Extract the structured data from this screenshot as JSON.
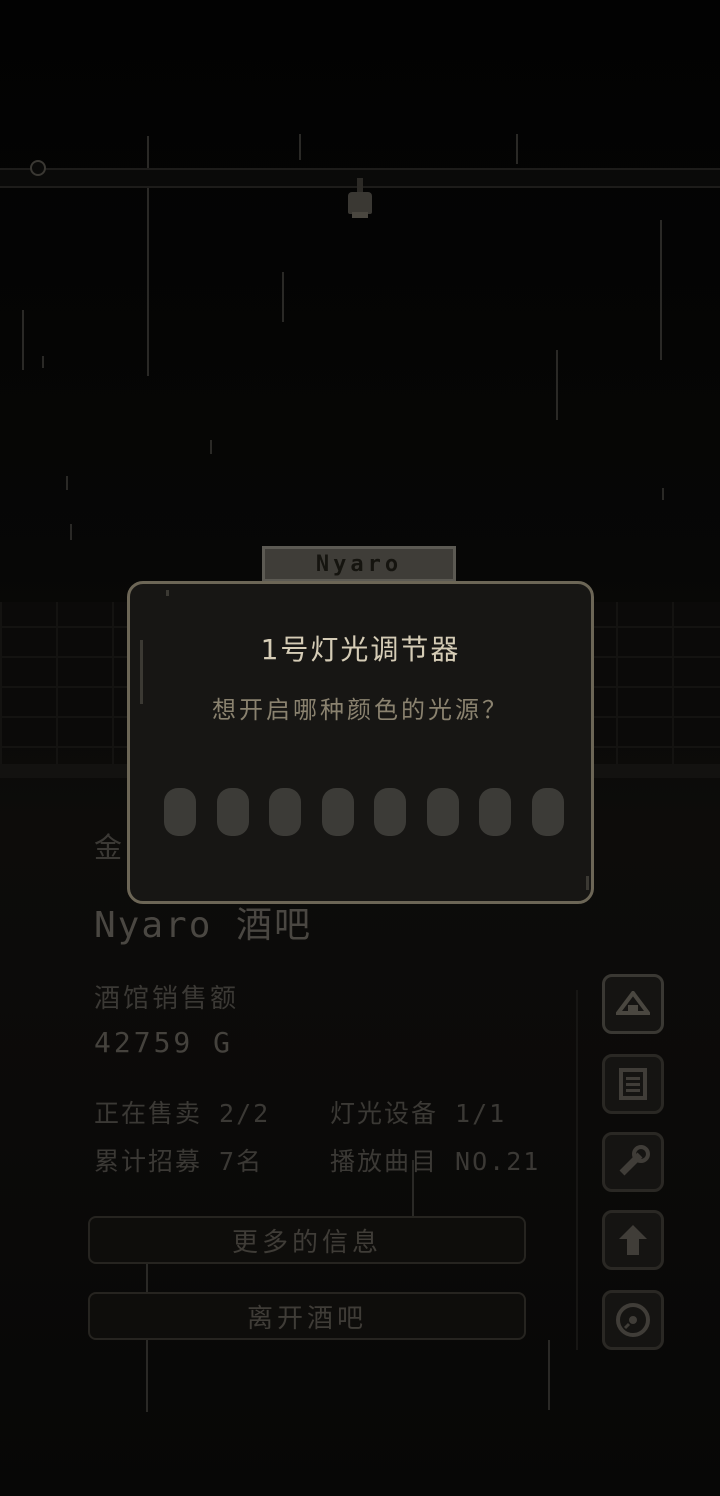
{
  "sign": {
    "text": "Nyaro"
  },
  "dialog": {
    "title": "1号灯光调节器",
    "question": "想开启哪种颜色的光源？",
    "color_options": 8
  },
  "bar_panel": {
    "gold_label": "金",
    "name": "Nyaro 酒吧",
    "sales_label": "酒馆销售额",
    "sales_value": "42759 G",
    "stats": {
      "selling": "正在售卖 2/2",
      "lights": "灯光设备 1/1",
      "recruited": "累计招募 7名",
      "track": "播放曲目 NO.21"
    },
    "more_info_label": "更多的信息",
    "leave_label": "离开酒吧"
  },
  "side_buttons": [
    {
      "icon": "hanger-icon"
    },
    {
      "icon": "menu-card-icon"
    },
    {
      "icon": "wrench-icon"
    },
    {
      "icon": "upgrade-arrow-icon"
    },
    {
      "icon": "vinyl-record-icon"
    }
  ],
  "colors": {
    "dialog_bg": "#171614",
    "dialog_border": "#6c6656",
    "title_text": "#d5ccb6",
    "question_text": "#8a826f",
    "color_option": "#3c3b37"
  }
}
